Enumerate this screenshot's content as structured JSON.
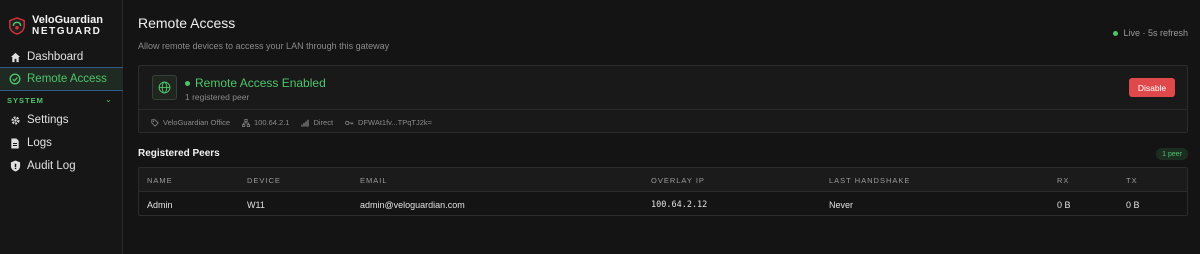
{
  "brand": {
    "name": "VeloGuardian",
    "sub": "NETGUARD"
  },
  "sidebar": {
    "items": [
      {
        "label": "Dashboard",
        "icon": "home-icon"
      },
      {
        "label": "Remote Access",
        "icon": "remote-access-icon",
        "active": true
      },
      {
        "label": "Settings",
        "icon": "gear-icon"
      },
      {
        "label": "Logs",
        "icon": "document-icon"
      },
      {
        "label": "Audit Log",
        "icon": "shield-icon"
      }
    ],
    "section_label": "SYSTEM"
  },
  "header": {
    "title": "Remote Access",
    "subtitle": "Allow remote devices to access your LAN through this gateway",
    "live": "Live · 5s refresh"
  },
  "status_card": {
    "status": "Remote Access Enabled",
    "peers": "1 registered peer",
    "disable_label": "Disable",
    "meta": {
      "name": "VeloGuardian Office",
      "ip": "100.64.2.1",
      "connection": "Direct",
      "key": "DFWAt1fv...TPqTJ2k="
    }
  },
  "peers": {
    "title": "Registered Peers",
    "badge": "1 peer",
    "columns": [
      "NAME",
      "DEVICE",
      "EMAIL",
      "OVERLAY IP",
      "LAST HANDSHAKE",
      "RX",
      "TX"
    ],
    "rows": [
      {
        "name": "Admin",
        "device": "W11",
        "email": "admin@veloguardian.com",
        "overlay_ip": "100.64.2.12",
        "last_handshake": "Never",
        "rx": "0 B",
        "tx": "0 B"
      }
    ]
  },
  "colors": {
    "accent": "#4ec46a",
    "danger": "#e0494c",
    "background": "#141414"
  }
}
